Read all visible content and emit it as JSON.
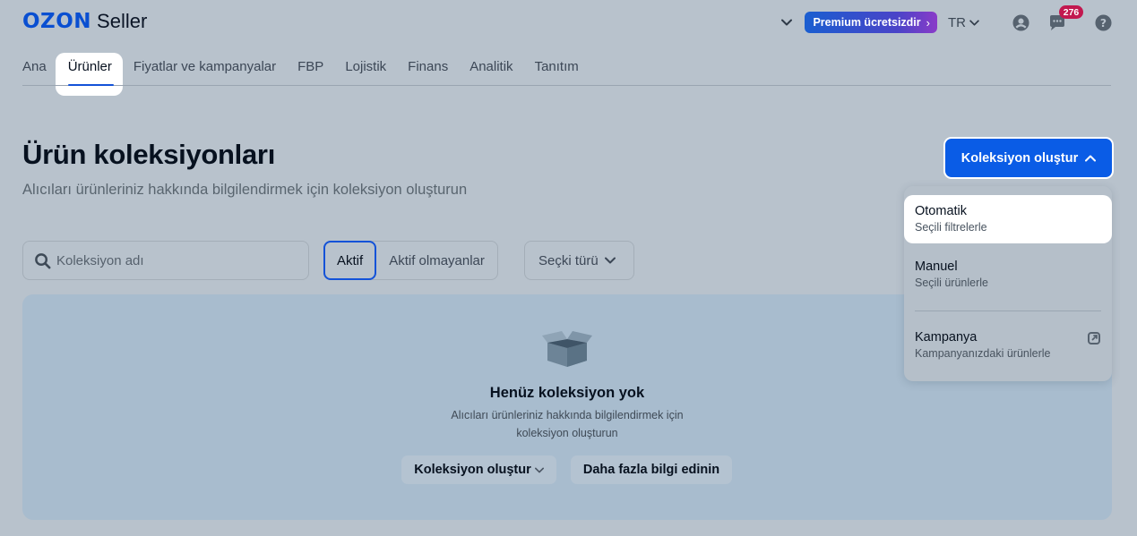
{
  "header": {
    "logo_brand": "OZON",
    "logo_product": "Seller",
    "premium_label": "Premium ücretsizdir",
    "language": "TR",
    "notifications_count": "276"
  },
  "nav": {
    "items": [
      "Ana",
      "Ürünler",
      "Fiyatlar ve kampanyalar",
      "FBP",
      "Lojistik",
      "Finans",
      "Analitik",
      "Tanıtım"
    ],
    "active": "Ürünler"
  },
  "page": {
    "title": "Ürün koleksiyonları",
    "subtitle": "Alıcıları ürünleriniz hakkında bilgilendirmek için koleksiyon oluşturun",
    "create_button": "Koleksiyon oluştur"
  },
  "filters": {
    "search_placeholder": "Koleksiyon adı",
    "status_tabs": [
      "Aktif",
      "Aktif olmayanlar"
    ],
    "active_tab": "Aktif",
    "type_select": "Seçki türü"
  },
  "empty_state": {
    "title": "Henüz koleksiyon yok",
    "text_line1": "Alıcıları ürünleriniz hakkında bilgilendirmek için",
    "text_line2": "koleksiyon oluşturun",
    "create_button": "Koleksiyon oluştur",
    "learn_more_button": "Daha fazla bilgi edinin"
  },
  "dropdown": {
    "items": [
      {
        "title": "Otomatik",
        "subtitle": "Seçili filtrelerle"
      },
      {
        "title": "Manuel",
        "subtitle": "Seçili ürünlerle"
      },
      {
        "title": "Kampanya",
        "subtitle": "Kampanyanızdaki ürünlerle"
      }
    ]
  },
  "colors": {
    "accent": "#0a5ce6",
    "brand": "#0a4fd1",
    "badge": "#c2184f"
  }
}
